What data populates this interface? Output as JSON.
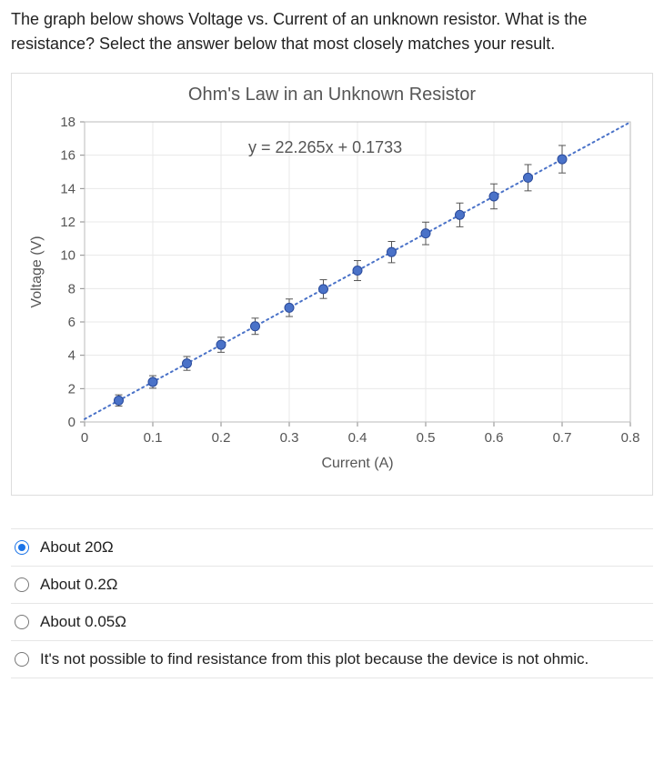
{
  "question": "The graph below shows Voltage vs. Current of an unknown resistor. What is the resistance? Select the answer below that most closely matches your result.",
  "chart_data": {
    "type": "scatter",
    "title": "Ohm's Law in an Unknown Resistor",
    "equation": "y = 22.265x + 0.1733",
    "xlabel": "Current (A)",
    "ylabel": "Voltage (V)",
    "xlim": [
      0,
      0.8
    ],
    "ylim": [
      0,
      18
    ],
    "xticks": [
      0,
      0.1,
      0.2,
      0.3,
      0.4,
      0.5,
      0.6,
      0.7,
      0.8
    ],
    "yticks": [
      0,
      2,
      4,
      6,
      8,
      10,
      12,
      14,
      16,
      18
    ],
    "x": [
      0.05,
      0.1,
      0.15,
      0.2,
      0.25,
      0.3,
      0.35,
      0.4,
      0.45,
      0.5,
      0.55,
      0.6,
      0.65,
      0.7
    ],
    "y": [
      1.29,
      2.4,
      3.51,
      4.63,
      5.74,
      6.85,
      7.97,
      9.08,
      10.19,
      11.31,
      12.42,
      13.53,
      14.65,
      15.76
    ],
    "trend_slope": 22.265,
    "trend_intercept": 0.1733,
    "point_color": "#4a72c8",
    "trend_color": "#4a72c8"
  },
  "options": [
    {
      "label": "About 20Ω",
      "selected": true
    },
    {
      "label": "About 0.2Ω",
      "selected": false
    },
    {
      "label": "About 0.05Ω",
      "selected": false
    },
    {
      "label": "It's not possible to find resistance from this plot because the device is not ohmic.",
      "selected": false
    }
  ]
}
